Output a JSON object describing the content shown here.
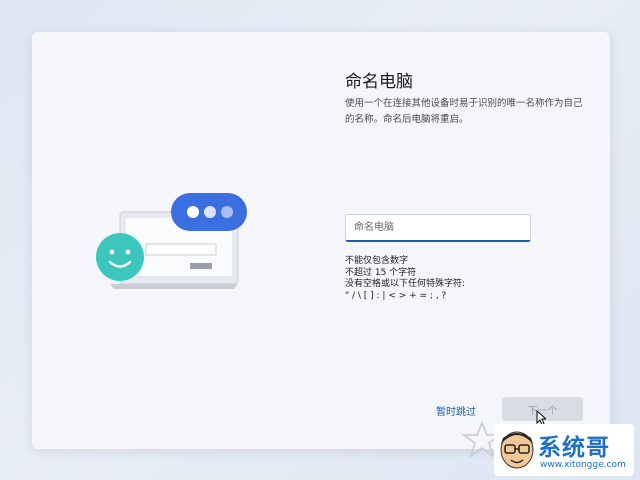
{
  "page": {
    "title": "命名电脑",
    "description": "使用一个在连接其他设备时易于识别的唯一名称作为自己的名称。命名后电脑将重启。"
  },
  "input": {
    "placeholder": "命名电脑",
    "value": ""
  },
  "rules": [
    "不能仅包含数字",
    "不超过 15 个字符",
    "没有空格或以下任何特殊字符:",
    "\" / \\ [ ] : | < > + = ; , ?"
  ],
  "actions": {
    "skip_label": "暂时跳过",
    "next_label": "下一个"
  },
  "watermark": {
    "brand": "系统哥",
    "url": "www.xitongge.com"
  },
  "colors": {
    "accent": "#1a5fb4",
    "bubble_blue": "#3b6fe0",
    "smiley_teal": "#3cc6bd"
  }
}
